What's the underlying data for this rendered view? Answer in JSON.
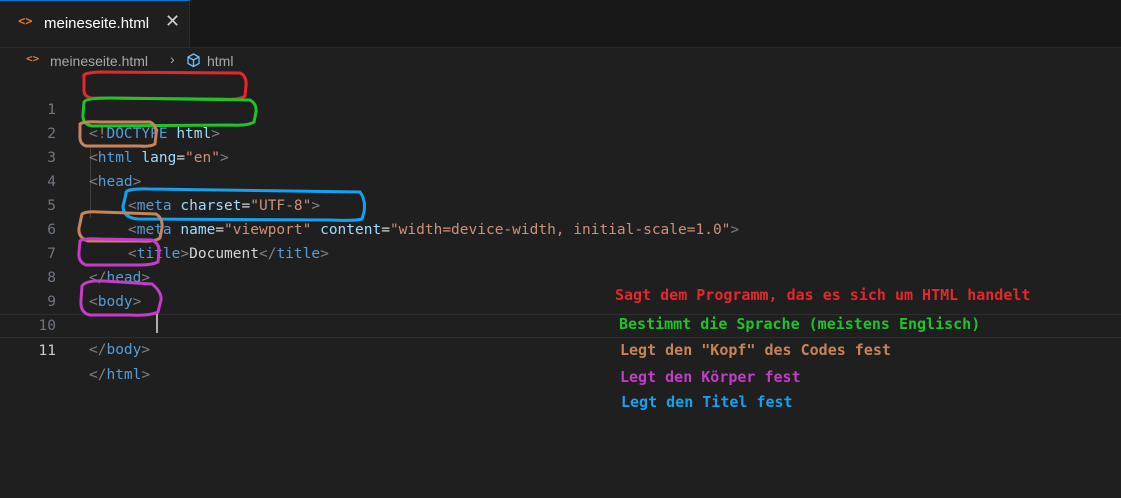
{
  "tab": {
    "icon": "<>",
    "label": "meineseite.html",
    "close": "✕"
  },
  "breadcrumb": {
    "file_icon": "<>",
    "file": "meineseite.html",
    "sep": "›",
    "symbol": "html"
  },
  "editor": {
    "line_numbers": [
      "1",
      "2",
      "3",
      "4",
      "5",
      "6",
      "7",
      "8",
      "9",
      "10",
      "11"
    ],
    "current_line": "11"
  },
  "code": {
    "l1": {
      "p1": "<!",
      "tag": "DOCTYPE",
      "sp": " ",
      "attr": "html",
      "p2": ">"
    },
    "l2": {
      "p1": "<",
      "tag": "html",
      "sp": " ",
      "attr": "lang",
      "eq": "=",
      "val": "\"en\"",
      "p2": ">"
    },
    "l3": {
      "p1": "<",
      "tag": "head",
      "p2": ">"
    },
    "l4": {
      "p1": "<",
      "tag": "meta",
      "sp": " ",
      "attr": "charset",
      "eq": "=",
      "val": "\"UTF-8\"",
      "p2": ">"
    },
    "l5": {
      "p1": "<",
      "tag": "meta",
      "sp": " ",
      "attr1": "name",
      "eq1": "=",
      "val1": "\"viewport\"",
      "sp2": " ",
      "attr2": "content",
      "eq2": "=",
      "val2": "\"width=device-width, initial-scale=1.0\"",
      "p2": ">"
    },
    "l6": {
      "p1": "<",
      "tag": "title",
      "p2": ">",
      "text": "Document",
      "p3": "</",
      "tag2": "title",
      "p4": ">"
    },
    "l7": {
      "p1": "</",
      "tag": "head",
      "p2": ">"
    },
    "l8": {
      "p1": "<",
      "tag": "body",
      "p2": ">"
    },
    "l10": {
      "p1": "</",
      "tag": "body",
      "p2": ">"
    },
    "l11": {
      "p1": "</",
      "tag": "html",
      "p2": ">"
    }
  },
  "annotations": {
    "doctype": "Sagt dem Programm, das es sich um HTML handelt",
    "lang": "Bestimmt die Sprache (meistens Englisch)",
    "head": "Legt den \"Kopf\" des Codes fest",
    "body": "Legt den Körper fest",
    "title": "Legt den Titel fest"
  },
  "colors": {
    "red": "#e8262b",
    "green": "#1ec42a",
    "brown": "#c8835a",
    "purple": "#c43cc7",
    "blue": "#12a3f0"
  }
}
